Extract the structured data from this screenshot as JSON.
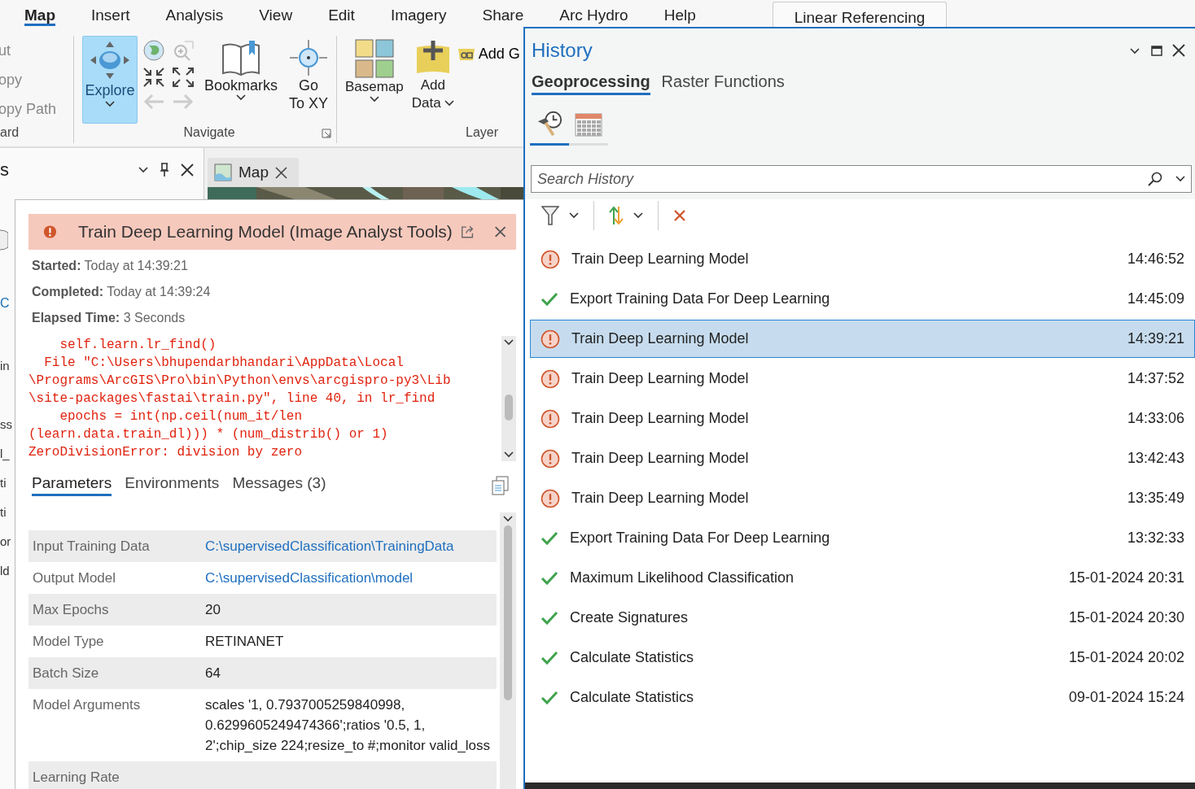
{
  "ribbon": {
    "tabs": [
      {
        "label": "Map",
        "selected": true,
        "kind": "core"
      },
      {
        "label": "Insert",
        "selected": false,
        "kind": "core"
      },
      {
        "label": "Analysis",
        "selected": false,
        "kind": "core"
      },
      {
        "label": "View",
        "selected": false,
        "kind": "core"
      },
      {
        "label": "Edit",
        "selected": false,
        "kind": "core"
      },
      {
        "label": "Imagery",
        "selected": false,
        "kind": "core"
      },
      {
        "label": "Share",
        "selected": false,
        "kind": "core"
      },
      {
        "label": "Arc Hydro",
        "selected": false,
        "kind": "core"
      },
      {
        "label": "Help",
        "selected": false,
        "kind": "core"
      },
      {
        "label": "Linear Referencing",
        "selected": false,
        "kind": "contextual"
      }
    ],
    "clipboard": {
      "items": [
        "ut",
        "opy",
        "opy Path"
      ],
      "group_label": "ard"
    },
    "navigate": {
      "explore": {
        "label": "Explore",
        "selected": true
      },
      "bookmarks": "Bookmarks",
      "go_to_xy": [
        "Go",
        "To XY"
      ],
      "group_label": "Navigate"
    },
    "layer": {
      "basemap": "Basemap",
      "add_data": [
        "Add",
        "Data"
      ],
      "add_graphics": "Add G",
      "group_label": "Layer"
    }
  },
  "contents_pane": {
    "title": "s",
    "fragments": [
      "C",
      "in",
      "ss",
      "l_",
      "ti",
      "ti",
      "or",
      "ld"
    ]
  },
  "map_tab": {
    "label": "Map"
  },
  "popup": {
    "title": "Train Deep Learning Model (Image Analyst Tools)",
    "kind": "error",
    "info": [
      "**Started:** Today at 14:39:21",
      "**Completed:** Today at 14:39:24",
      "**Elapsed Time:** 3 Seconds"
    ],
    "traceback": [
      "    self.learn.lr_find()",
      "  File \"C:\\Users\\bhupendarbhandari\\AppData\\Local",
      "\\Programs\\ArcGIS\\Pro\\bin\\Python\\envs\\arcgispro-py3\\Lib",
      "\\site-packages\\fastai\\train.py\", line 40, in lr_find",
      "    epochs = int(np.ceil(num_it/len",
      "(learn.data.train_dl))) * (num_distrib() or 1)",
      "ZeroDivisionError: division by zero"
    ],
    "tabs": [
      {
        "label": "Parameters",
        "selected": true
      },
      {
        "label": "Environments",
        "selected": false
      },
      {
        "label": "Messages (3)",
        "selected": false
      }
    ],
    "parameters": [
      {
        "name": "Input Training Data",
        "value": "C:\\supervisedClassification\\TrainingData",
        "kind": "link"
      },
      {
        "name": "Output Model",
        "value": "C:\\supervisedClassification\\model",
        "kind": "link"
      },
      {
        "name": "Max Epochs",
        "value": "20",
        "kind": "text"
      },
      {
        "name": "Model Type",
        "value": "RETINANET",
        "kind": "text"
      },
      {
        "name": "Batch Size",
        "value": "64",
        "kind": "text"
      },
      {
        "name": "Model Arguments",
        "value": "scales '1, 0.7937005259840998, 0.6299605249474366';ratios '0.5, 1, 2';chip_size 224;resize_to #;monitor valid_loss",
        "kind": "text"
      },
      {
        "name": "Learning Rate"
      }
    ]
  },
  "history": {
    "title": "History",
    "tabs": [
      {
        "label": "Geoprocessing",
        "selected": true
      },
      {
        "label": "Raster Functions",
        "selected": false
      }
    ],
    "view_tabs": [
      {
        "kind": "tools",
        "selected": true
      },
      {
        "kind": "calendar",
        "selected": false
      }
    ],
    "search": {
      "placeholder": "Search History"
    },
    "items": [
      {
        "name": "Train Deep Learning Model",
        "time": "14:46:52",
        "kind": "error",
        "selected": false
      },
      {
        "name": "Export Training Data For Deep Learning",
        "time": "14:45:09",
        "kind": "success",
        "selected": false
      },
      {
        "name": "Train Deep Learning Model",
        "time": "14:39:21",
        "kind": "error",
        "selected": true
      },
      {
        "name": "Train Deep Learning Model",
        "time": "14:37:52",
        "kind": "error",
        "selected": false
      },
      {
        "name": "Train Deep Learning Model",
        "time": "14:33:06",
        "kind": "error",
        "selected": false
      },
      {
        "name": "Train Deep Learning Model",
        "time": "13:42:43",
        "kind": "error",
        "selected": false
      },
      {
        "name": "Train Deep Learning Model",
        "time": "13:35:49",
        "kind": "error",
        "selected": false
      },
      {
        "name": "Export Training Data For Deep Learning",
        "time": "13:32:33",
        "kind": "success",
        "selected": false
      },
      {
        "name": "Maximum Likelihood Classification",
        "time": "15-01-2024 20:31",
        "kind": "success",
        "selected": false
      },
      {
        "name": "Create Signatures",
        "time": "15-01-2024 20:30",
        "kind": "success",
        "selected": false
      },
      {
        "name": "Calculate Statistics",
        "time": "15-01-2024 20:02",
        "kind": "success",
        "selected": false
      },
      {
        "name": "Calculate Statistics",
        "time": "09-01-2024 15:24",
        "kind": "success",
        "selected": false
      }
    ]
  }
}
